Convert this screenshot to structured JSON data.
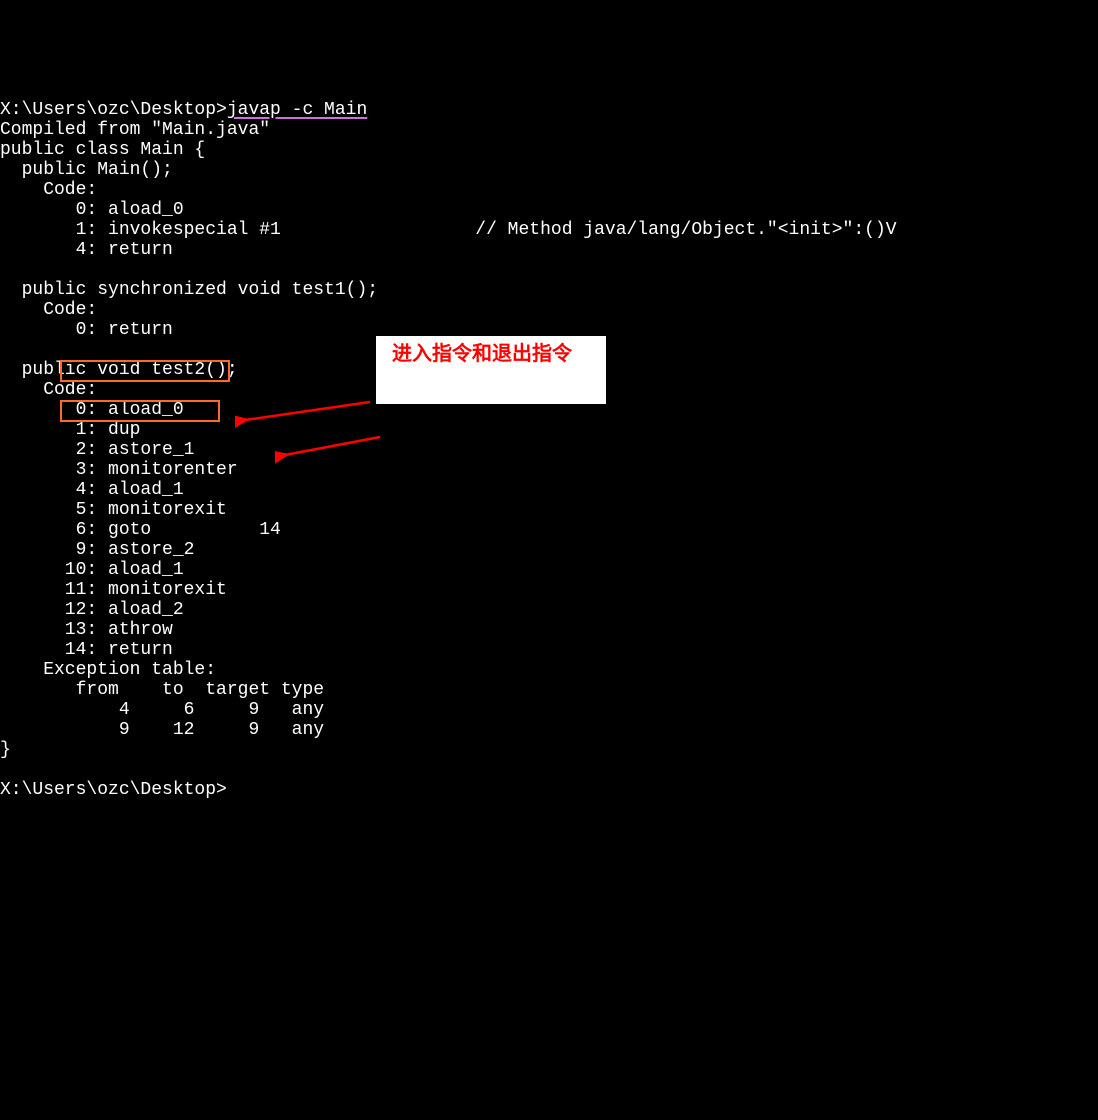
{
  "prompt1_path": "X:\\Users\\ozc\\Desktop>",
  "prompt1_cmd": "javap -c Main",
  "compiled_from": "Compiled from \"Main.java\"",
  "class_decl": "public class Main {",
  "ctor_sig": "  public Main();",
  "code_label": "    Code:",
  "ctor_l0": "       0: aload_0",
  "ctor_l1": "       1: invokespecial #1                  // Method java/lang/Object.\"<init>\":()V",
  "ctor_l4": "       4: return",
  "blank": "",
  "test1_sig": "  public synchronized void test1();",
  "test1_l0": "       0: return",
  "test2_sig": "  public void test2();",
  "test2_l0": "       0: aload_0",
  "test2_l1": "       1: dup",
  "test2_l2": "       2: astore_1",
  "test2_l3": "       3: monitorenter",
  "test2_l4": "       4: aload_1",
  "test2_l5": "       5: monitorexit",
  "test2_l6": "       6: goto          14",
  "test2_l9": "       9: astore_2",
  "test2_l10": "      10: aload_1",
  "test2_l11": "      11: monitorexit",
  "test2_l12": "      12: aload_2",
  "test2_l13": "      13: athrow",
  "test2_l14": "      14: return",
  "exc_table": "    Exception table:",
  "exc_header": "       from    to  target type",
  "exc_row1": "           4     6     9   any",
  "exc_row2": "           9    12     9   any",
  "class_close": "}",
  "prompt2_path": "X:\\Users\\ozc\\Desktop>",
  "annotation_text": "进入指令和退出指令"
}
